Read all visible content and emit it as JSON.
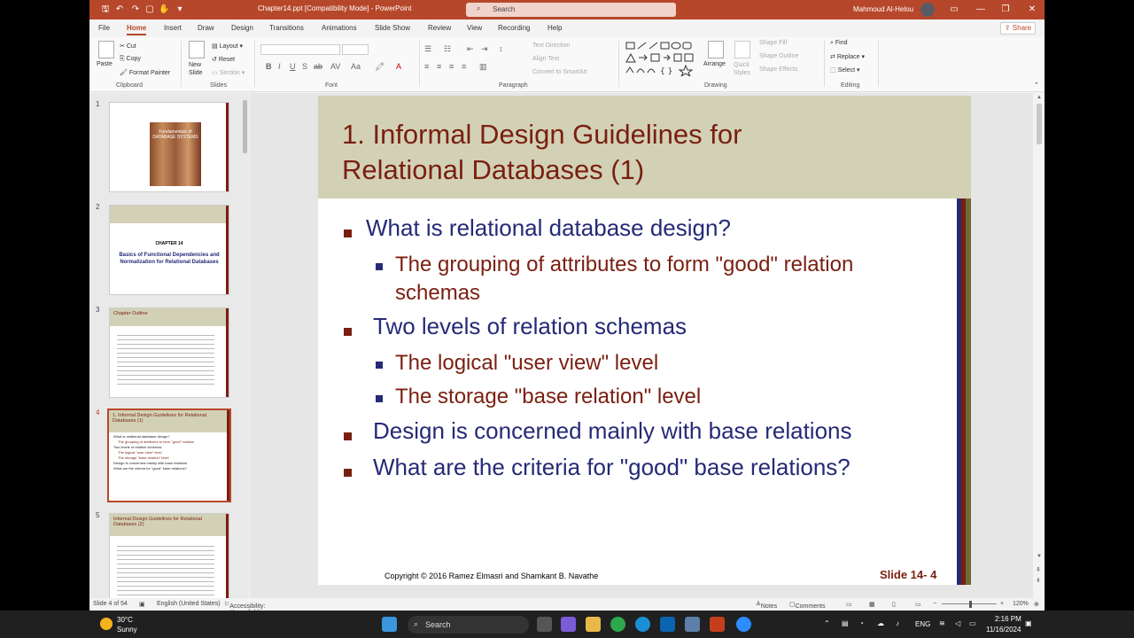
{
  "titlebar": {
    "doc_title": "Chapter14.ppt [Compatibility Mode] - PowerPoint",
    "search_placeholder": "Search",
    "user": "Mahmoud Al-Helou"
  },
  "menu": {
    "tabs": [
      "File",
      "Home",
      "Insert",
      "Draw",
      "Design",
      "Transitions",
      "Animations",
      "Slide Show",
      "Review",
      "View",
      "Recording",
      "Help"
    ],
    "share": "Share"
  },
  "ribbon": {
    "paste": "Paste",
    "cut": "Cut",
    "copy": "Copy",
    "format_painter": "Format Painter",
    "clipboard": "Clipboard",
    "new_slide": "New Slide",
    "layout": "Layout",
    "reset": "Reset",
    "section": "Section",
    "slides": "Slides",
    "font_group": "Font",
    "text_direction": "Text Direction",
    "align_text": "Align Text",
    "convert_smartart": "Convert to SmartArt",
    "paragraph": "Paragraph",
    "arrange": "Arrange",
    "quick_styles": "Quick Styles",
    "shape_fill": "Shape Fill",
    "shape_outline": "Shape Outline",
    "shape_effects": "Shape Effects",
    "drawing": "Drawing",
    "find": "Find",
    "replace": "Replace",
    "select": "Select",
    "editing": "Editing"
  },
  "thumbnails": [
    {
      "num": "1",
      "title": "Fundamentals of DATABASE SYSTEMS"
    },
    {
      "num": "2",
      "chapter": "CHAPTER 14",
      "title": "Basics of Functional Dependencies and Normalization for Relational Databases"
    },
    {
      "num": "3",
      "title": "Chapter Outline"
    },
    {
      "num": "4",
      "title": "1. Informal Design Guidelines for Relational Databases (1)"
    },
    {
      "num": "5",
      "title": "Informal Design Guidelines for Relational Databases (2)"
    }
  ],
  "slide": {
    "title_line1": "1. Informal Design Guidelines for",
    "title_line2": "Relational Databases (1)",
    "bullet1": "What is relational database design?",
    "sub1a": "The grouping of attributes to form \"good\" relation",
    "sub1b": "schemas",
    "bullet2": "Two levels of relation schemas",
    "sub2a": "The logical \"user view\" level",
    "sub2b": "The storage \"base relation\" level",
    "bullet3": "Design is concerned mainly with base relations",
    "bullet4": "What are the criteria for \"good\" base relations?",
    "copyright": "Copyright © 2016 Ramez Elmasri and Shamkant B. Navathe",
    "slide_no": "Slide 14- 4"
  },
  "status": {
    "slide_of": "Slide 4 of 54",
    "language": "English (United States)",
    "accessibility": "Accessibility: Unavailable",
    "notes": "Notes",
    "comments": "Comments",
    "zoom": "120%"
  },
  "taskbar": {
    "weather_temp": "30°C",
    "weather_desc": "Sunny",
    "search": "Search",
    "lang": "ENG",
    "time": "2:16 PM",
    "date": "11/16/2024"
  },
  "colors": {
    "accent": "#b7472a",
    "slide_title": "#7a1f10",
    "slide_header_bg": "#d2d1b6",
    "bullet_blue": "#252a76"
  }
}
